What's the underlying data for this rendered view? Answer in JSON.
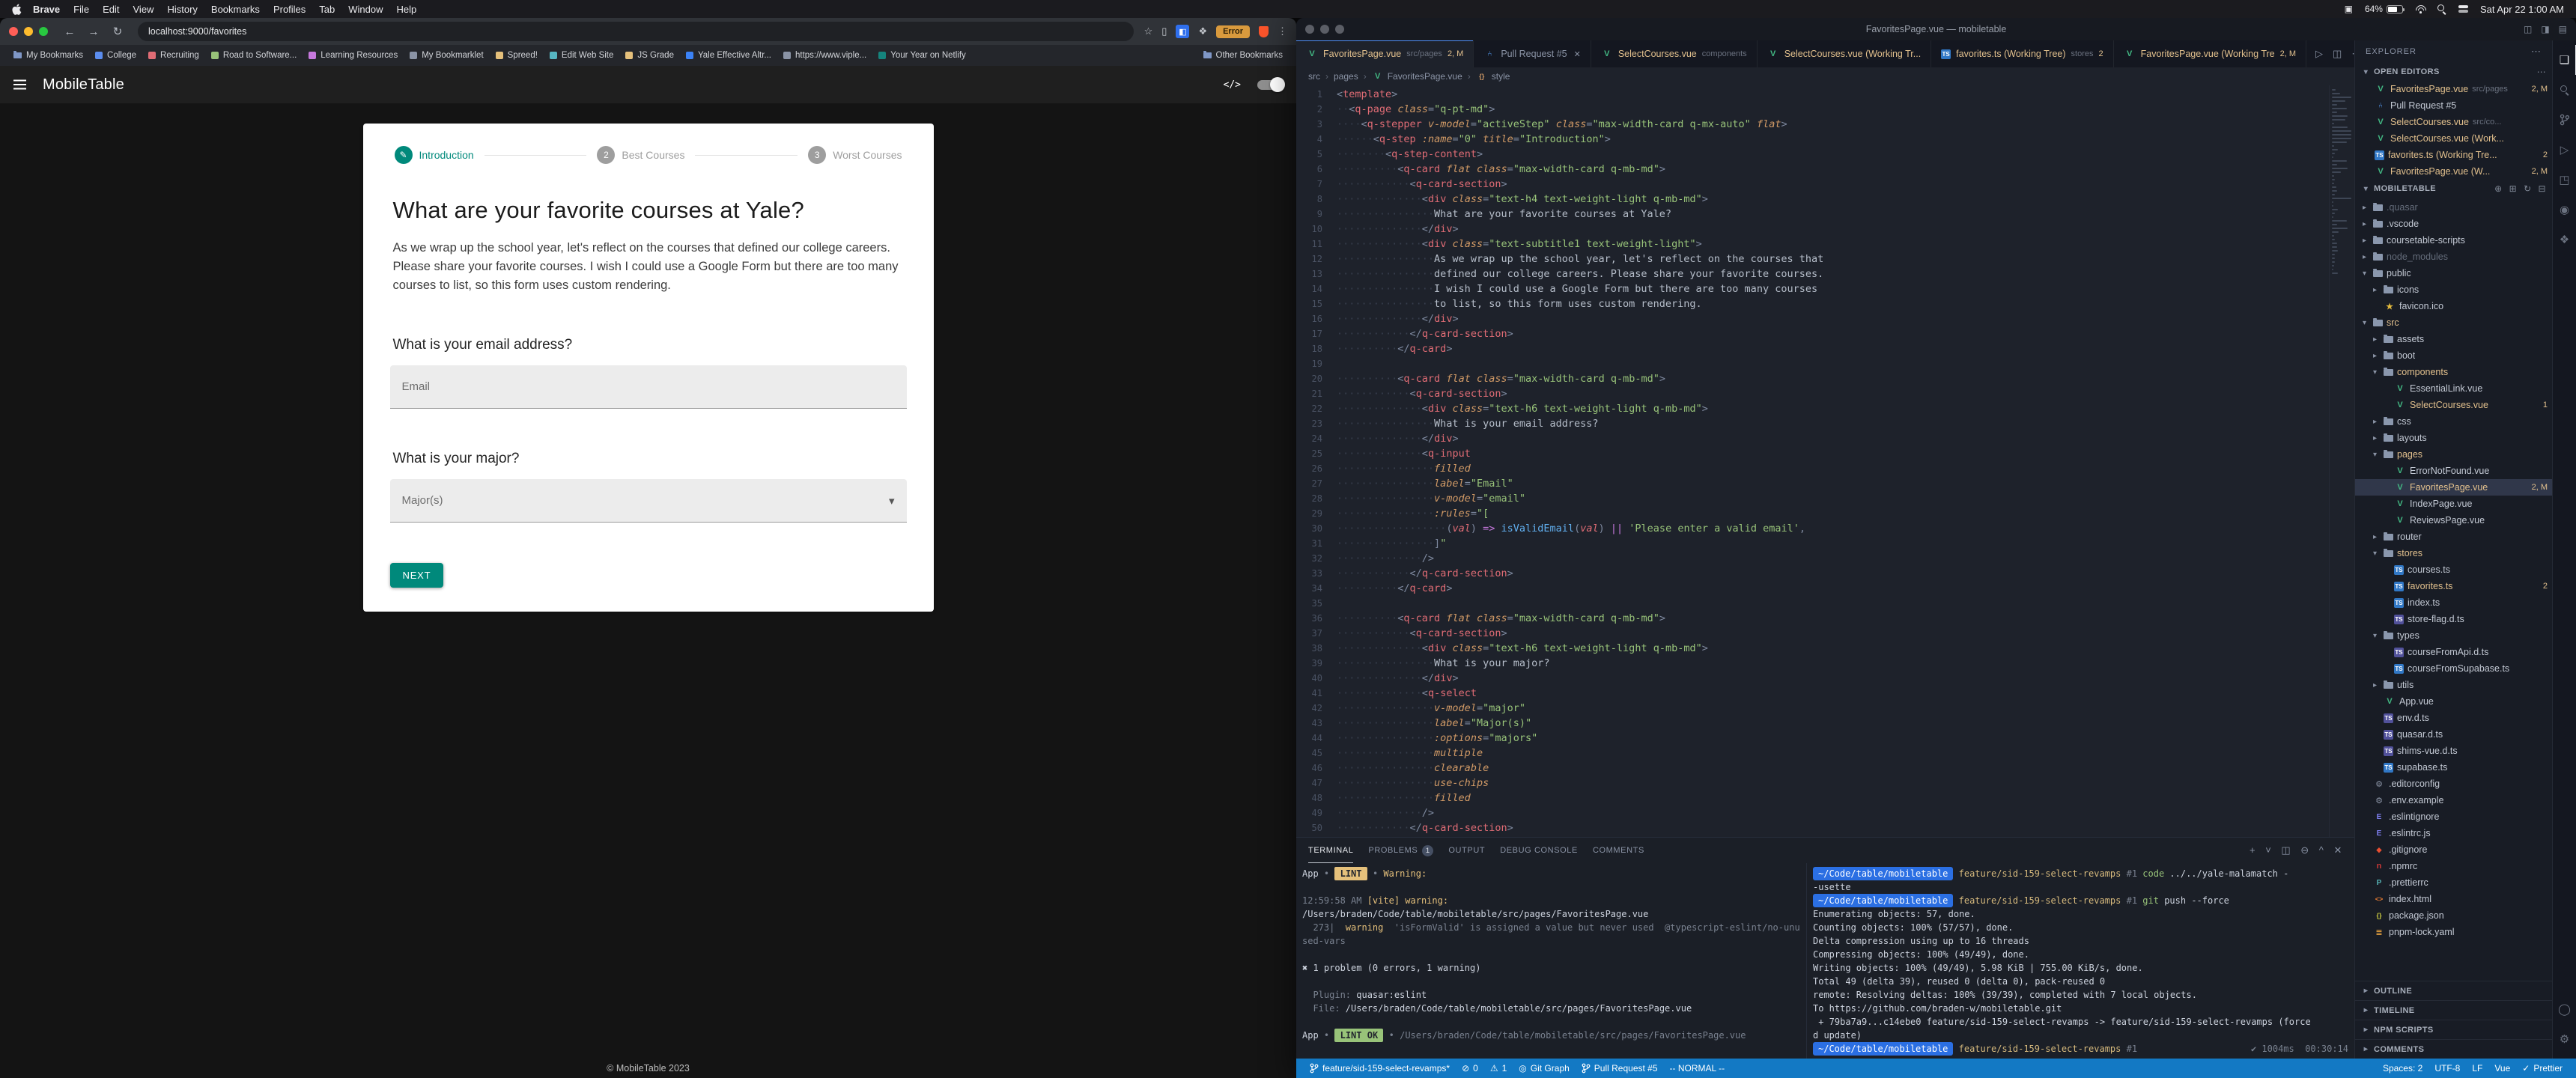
{
  "menubar": {
    "items": [
      "Brave",
      "File",
      "Edit",
      "View",
      "History",
      "Bookmarks",
      "Profiles",
      "Tab",
      "Window",
      "Help"
    ],
    "battery": "64%",
    "clock": "Sat Apr 22 1:00 AM"
  },
  "browser": {
    "url": "localhost:9000/favorites",
    "error_badge": "Error",
    "bookmarks": [
      {
        "label": "My Bookmarks",
        "type": "folder"
      },
      {
        "label": "College",
        "color": "#5b8def"
      },
      {
        "label": "Recruiting",
        "color": "#e06c75"
      },
      {
        "label": "Road to Software...",
        "color": "#98c379"
      },
      {
        "label": "Learning Resources",
        "color": "#c678dd"
      },
      {
        "label": "My Bookmarklet",
        "color": "#8a93a5"
      },
      {
        "label": "Spreed!",
        "color": "#e5c07b"
      },
      {
        "label": "Edit Web Site",
        "color": "#56b6c2"
      },
      {
        "label": "JS Grade",
        "color": "#e5c07b"
      },
      {
        "label": "Yale Effective Altr...",
        "color": "#3b82f6"
      },
      {
        "label": "https://www.viple...",
        "color": "#8a93a5"
      },
      {
        "label": "Your Year on Netlify",
        "color": "#15847d"
      }
    ],
    "other_bookmarks": "Other Bookmarks"
  },
  "webapp": {
    "header_title": "MobileTable",
    "primary_color": "#00897b",
    "steps": [
      {
        "label": "Introduction",
        "state": "active"
      },
      {
        "label": "Best Courses",
        "state": "inactive"
      },
      {
        "label": "Worst Courses",
        "state": "inactive"
      }
    ],
    "heading": "What are your favorite courses at Yale?",
    "description": "As we wrap up the school year, let's reflect on the courses that defined our college careers. Please share your favorite courses. I wish I could use a Google Form but there are too many courses to list, so this form uses custom rendering.",
    "email_question": "What is your email address?",
    "email_placeholder": "Email",
    "major_question": "What is your major?",
    "major_placeholder": "Major(s)",
    "next_label": "NEXT",
    "footer": "© MobileTable 2023"
  },
  "vscode": {
    "window_title": "FavoritesPage.vue — mobiletable",
    "tabs": [
      {
        "label": "FavoritesPage.vue",
        "icon": "vue",
        "desc": "src/pages",
        "badge": "2, M",
        "active": true,
        "modified": true
      },
      {
        "label": "Pull Request #5",
        "icon": "pr",
        "close": true
      },
      {
        "label": "SelectCourses.vue",
        "icon": "vue",
        "desc": "components",
        "modified": true
      },
      {
        "label": "SelectCourses.vue (Working Tr...",
        "icon": "vue",
        "modified": true
      },
      {
        "label": "favorites.ts (Working Tree)",
        "icon": "ts",
        "desc": "stores",
        "badge": "2",
        "modified": true
      },
      {
        "label": "FavoritesPage.vue (Working Tre",
        "icon": "vue",
        "badge": "2, M",
        "modified": true
      }
    ],
    "breadcrumb": [
      {
        "label": "src"
      },
      {
        "label": "pages"
      },
      {
        "label": "FavoritesPage.vue",
        "icon": "vue"
      },
      {
        "label": "style",
        "icon": "sym"
      }
    ],
    "editor_lines": [
      "<template>",
      "  <q-page class=\"q-pt-md\">",
      "    <q-stepper v-model=\"activeStep\" class=\"max-width-card q-mx-auto\" flat>",
      "      <q-step :name=\"0\" title=\"Introduction\">",
      "        <q-step-content>",
      "          <q-card flat class=\"max-width-card q-mb-md\">",
      "            <q-card-section>",
      "              <div class=\"text-h4 text-weight-light q-mb-md\">",
      "                What are your favorite courses at Yale?",
      "              </div>",
      "              <div class=\"text-subtitle1 text-weight-light\">",
      "                As we wrap up the school year, let's reflect on the courses that",
      "                defined our college careers. Please share your favorite courses.",
      "                I wish I could use a Google Form but there are too many courses",
      "                to list, so this form uses custom rendering.",
      "              </div>",
      "            </q-card-section>",
      "          </q-card>",
      "",
      "          <q-card flat class=\"max-width-card q-mb-md\">",
      "            <q-card-section>",
      "              <div class=\"text-h6 text-weight-light q-mb-md\">",
      "                What is your email address?",
      "              </div>",
      "              <q-input",
      "                filled",
      "                label=\"Email\"",
      "                v-model=\"email\"",
      "                :rules=\"[",
      "                  (val) => isValidEmail(val) || 'Please enter a valid email',",
      "                ]\"",
      "              />",
      "            </q-card-section>",
      "          </q-card>",
      "",
      "          <q-card flat class=\"max-width-card q-mb-md\">",
      "            <q-card-section>",
      "              <div class=\"text-h6 text-weight-light q-mb-md\">",
      "                What is your major?",
      "              </div>",
      "              <q-select",
      "                v-model=\"major\"",
      "                label=\"Major(s)\"",
      "                :options=\"majors\"",
      "                multiple",
      "                clearable",
      "                use-chips",
      "                filled",
      "              />",
      "            </q-card-section>"
    ],
    "explorer": {
      "title": "EXPLORER",
      "open_editors_title": "OPEN EDITORS",
      "open_editors": [
        {
          "name": "FavoritesPage.vue",
          "icon": "vue",
          "desc": "src/pages",
          "badge": "2, M",
          "modified": true
        },
        {
          "name": "Pull Request #5",
          "icon": "pr"
        },
        {
          "name": "SelectCourses.vue",
          "icon": "vue",
          "desc": "src/co...",
          "modified": true
        },
        {
          "name": "SelectCourses.vue (Work...",
          "icon": "vue",
          "modified": true
        },
        {
          "name": "favorites.ts (Working Tre...",
          "icon": "ts",
          "badge": "2",
          "modified": true
        },
        {
          "name": "FavoritesPage.vue (W...",
          "icon": "vue",
          "badge": "2, M",
          "modified": true
        }
      ],
      "root": "MOBILETABLE",
      "tree": [
        {
          "n": ".quasar",
          "i": "folder",
          "d": 0,
          "cls": "dim"
        },
        {
          "n": ".vscode",
          "i": "folder",
          "d": 0
        },
        {
          "n": "coursetable-scripts",
          "i": "folder",
          "d": 0
        },
        {
          "n": "node_modules",
          "i": "folder",
          "d": 0,
          "cls": "dim"
        },
        {
          "n": "public",
          "i": "folder",
          "d": 0,
          "exp": true
        },
        {
          "n": "icons",
          "i": "folder",
          "d": 1
        },
        {
          "n": "favicon.ico",
          "i": "star",
          "d": 1
        },
        {
          "n": "src",
          "i": "folder",
          "d": 0,
          "exp": true,
          "cls": "mod"
        },
        {
          "n": "assets",
          "i": "folder",
          "d": 1
        },
        {
          "n": "boot",
          "i": "folder",
          "d": 1
        },
        {
          "n": "components",
          "i": "folder",
          "d": 1,
          "exp": true,
          "cls": "mod"
        },
        {
          "n": "EssentialLink.vue",
          "i": "vue",
          "d": 2
        },
        {
          "n": "SelectCourses.vue",
          "i": "vue",
          "d": 2,
          "cls": "mod",
          "b": "1"
        },
        {
          "n": "css",
          "i": "folder",
          "d": 1
        },
        {
          "n": "layouts",
          "i": "folder",
          "d": 1
        },
        {
          "n": "pages",
          "i": "folder",
          "d": 1,
          "exp": true,
          "cls": "mod"
        },
        {
          "n": "ErrorNotFound.vue",
          "i": "vue",
          "d": 2
        },
        {
          "n": "FavoritesPage.vue",
          "i": "vue",
          "d": 2,
          "cls": "mod",
          "b": "2, M",
          "sel": true
        },
        {
          "n": "IndexPage.vue",
          "i": "vue",
          "d": 2
        },
        {
          "n": "ReviewsPage.vue",
          "i": "vue",
          "d": 2
        },
        {
          "n": "router",
          "i": "folder",
          "d": 1
        },
        {
          "n": "stores",
          "i": "folder",
          "d": 1,
          "exp": true,
          "cls": "mod"
        },
        {
          "n": "courses.ts",
          "i": "ts",
          "d": 2
        },
        {
          "n": "favorites.ts",
          "i": "ts",
          "d": 2,
          "cls": "mod",
          "b": "2"
        },
        {
          "n": "index.ts",
          "i": "ts",
          "d": 2
        },
        {
          "n": "store-flag.d.ts",
          "i": "dts",
          "d": 2
        },
        {
          "n": "types",
          "i": "folder",
          "d": 1,
          "exp": true
        },
        {
          "n": "courseFromApi.d.ts",
          "i": "dts",
          "d": 2
        },
        {
          "n": "courseFromSupabase.ts",
          "i": "ts",
          "d": 2
        },
        {
          "n": "utils",
          "i": "folder",
          "d": 1
        },
        {
          "n": "App.vue",
          "i": "vue",
          "d": 1
        },
        {
          "n": "env.d.ts",
          "i": "dts",
          "d": 1
        },
        {
          "n": "quasar.d.ts",
          "i": "dts",
          "d": 1
        },
        {
          "n": "shims-vue.d.ts",
          "i": "dts",
          "d": 1
        },
        {
          "n": "supabase.ts",
          "i": "ts",
          "d": 1
        },
        {
          "n": ".editorconfig",
          "i": "cfg",
          "d": 0
        },
        {
          "n": ".env.example",
          "i": "cfg",
          "d": 0
        },
        {
          "n": ".eslintignore",
          "i": "eslint",
          "d": 0
        },
        {
          "n": ".eslintrc.js",
          "i": "eslint",
          "d": 0
        },
        {
          "n": ".gitignore",
          "i": "git",
          "d": 0
        },
        {
          "n": ".npmrc",
          "i": "npm",
          "d": 0
        },
        {
          "n": ".prettierrc",
          "i": "prettier",
          "d": 0
        },
        {
          "n": "index.html",
          "i": "html",
          "d": 0
        },
        {
          "n": "package.json",
          "i": "json",
          "d": 0
        },
        {
          "n": "pnpm-lock.yaml",
          "i": "yaml",
          "d": 0
        }
      ],
      "bottom_sections": [
        "OUTLINE",
        "TIMELINE",
        "NPM SCRIPTS",
        "COMMENTS"
      ]
    },
    "panel": {
      "tabs": [
        {
          "label": "TERMINAL",
          "active": true
        },
        {
          "label": "PROBLEMS",
          "badge": "1"
        },
        {
          "label": "OUTPUT"
        },
        {
          "label": "DEBUG CONSOLE"
        },
        {
          "label": "COMMENTS"
        }
      ],
      "left_lines": [
        [
          [
            "fg",
            "App"
          ],
          [
            "dim",
            " • "
          ],
          [
            "bwarn",
            " LINT "
          ],
          [
            "dim",
            " • "
          ],
          [
            "yel",
            "Warning:"
          ]
        ],
        [],
        [
          [
            "dim",
            "12:59:58 AM "
          ],
          [
            "yel",
            "[vite] warning:"
          ]
        ],
        [
          [
            "link",
            "/Users/braden/Code/table/mobiletable/src/pages/FavoritesPage.vue"
          ]
        ],
        [
          [
            "dim",
            "  273|  "
          ],
          [
            "yel",
            "warning"
          ],
          [
            "dim",
            "  'isFormValid' is assigned a value but never used  @typescript-eslint/no-unu"
          ]
        ],
        [
          [
            "dim",
            "sed-vars"
          ]
        ],
        [],
        [
          [
            "fg",
            "✖ 1 problem (0 errors, 1 warning)"
          ]
        ],
        [],
        [
          [
            "dim",
            "  Plugin: "
          ],
          [
            "fg",
            "quasar:eslint"
          ]
        ],
        [
          [
            "dim",
            "  File: "
          ],
          [
            "fg",
            "/Users/braden/Code/table/mobiletable/src/pages/FavoritesPage.vue"
          ]
        ],
        [],
        [
          [
            "fg",
            "App"
          ],
          [
            "dim",
            " • "
          ],
          [
            "bok",
            " LINT OK "
          ],
          [
            "dim",
            " • "
          ],
          [
            "dim",
            "/Users/braden/Code/table/mobiletable/src/pages/FavoritesPage.vue"
          ]
        ]
      ],
      "right_lines": [
        [
          [
            "chip",
            "~/Code/table/mobiletable"
          ],
          [
            "sp",
            " "
          ],
          [
            "branch",
            "feature/sid-159-select-revamps"
          ],
          [
            "dim",
            " #1 "
          ],
          [
            "grn",
            "code"
          ],
          [
            "fg",
            " ../../yale-malamatch -"
          ]
        ],
        [
          [
            "fg",
            "-usette"
          ]
        ],
        [
          [
            "chip",
            "~/Code/table/mobiletable"
          ],
          [
            "sp",
            " "
          ],
          [
            "branch",
            "feature/sid-159-select-revamps"
          ],
          [
            "dim",
            " #1 "
          ],
          [
            "grn",
            "git"
          ],
          [
            "fg",
            " push --force"
          ]
        ],
        [
          [
            "fg",
            "Enumerating objects: 57, done."
          ]
        ],
        [
          [
            "fg",
            "Counting objects: 100% (57/57), done."
          ]
        ],
        [
          [
            "fg",
            "Delta compression using up to 16 threads"
          ]
        ],
        [
          [
            "fg",
            "Compressing objects: 100% (49/49), done."
          ]
        ],
        [
          [
            "fg",
            "Writing objects: 100% (49/49), 5.98 KiB | 755.00 KiB/s, done."
          ]
        ],
        [
          [
            "fg",
            "Total 49 (delta 39), reused 0 (delta 0), pack-reused 0"
          ]
        ],
        [
          [
            "fg",
            "remote: Resolving deltas: 100% (39/39), completed with 7 local objects."
          ]
        ],
        [
          [
            "fg",
            "To https://github.com/braden-w/mobiletable.git"
          ]
        ],
        [
          [
            "fg",
            " + 79ba7a9...c14ebe0 feature/sid-159-select-revamps -> feature/sid-159-select-revamps (force"
          ]
        ],
        [
          [
            "fg",
            "d update)"
          ]
        ],
        [
          [
            "chip",
            "~/Code/table/mobiletable"
          ],
          [
            "sp",
            " "
          ],
          [
            "branch",
            "feature/sid-159-select-revamps"
          ],
          [
            "dim",
            " #1"
          ],
          [
            "right",
            "✔ 1004ms  00:30:14"
          ]
        ]
      ]
    },
    "statusbar": {
      "left": [
        {
          "icon": "branch",
          "label": "feature/sid-159-select-revamps*"
        },
        {
          "icon": "err",
          "label": "0"
        },
        {
          "icon": "warn",
          "label": "1"
        },
        {
          "icon": "graph",
          "label": "Git Graph"
        },
        {
          "icon": "pr",
          "label": "Pull Request #5"
        },
        {
          "label": "-- NORMAL --"
        }
      ],
      "right": [
        {
          "label": "Spaces: 2"
        },
        {
          "label": "UTF-8"
        },
        {
          "label": "LF"
        },
        {
          "label": "Vue"
        },
        {
          "icon": "check",
          "label": "Prettier"
        }
      ]
    }
  }
}
